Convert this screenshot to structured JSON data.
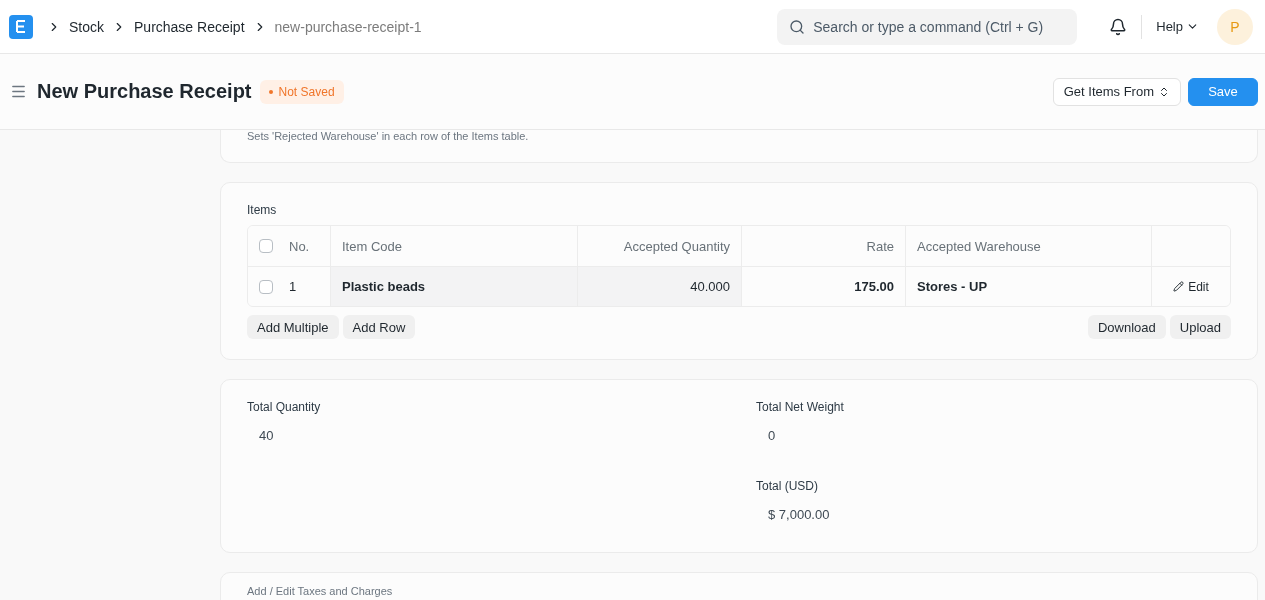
{
  "navbar": {
    "breadcrumbs": [
      {
        "label": "Stock",
        "current": false
      },
      {
        "label": "Purchase Receipt",
        "current": false
      },
      {
        "label": "new-purchase-receipt-1",
        "current": true
      }
    ],
    "search": {
      "placeholder": "Search or type a command (Ctrl + G)"
    },
    "help": "Help",
    "avatar": "P"
  },
  "page_head": {
    "title": "New Purchase Receipt",
    "status": "Not Saved",
    "buttons": [
      {
        "label": "Get Items From",
        "kind": "dropdown"
      },
      {
        "label": "Save",
        "kind": "primary"
      }
    ]
  },
  "rejected_hint": "Sets 'Rejected Warehouse' in each row of the Items table.",
  "items": {
    "label": "Items",
    "columns": [
      "No.",
      "Item Code",
      "Accepted Quantity",
      "Rate",
      "Accepted Warehouse"
    ],
    "rows": [
      {
        "checked": false,
        "no": "1",
        "item_code": "Plastic beads",
        "accepted_quantity": "40.000",
        "rate": "175.00",
        "accepted_warehouse": "Stores - UP",
        "edit": "Edit"
      }
    ],
    "left_buttons": [
      "Add Multiple",
      "Add Row"
    ],
    "right_buttons": [
      "Download",
      "Upload"
    ],
    "all_checked": false
  },
  "totals": [
    {
      "label": "Total Quantity",
      "value": "40"
    },
    {
      "label": "Total Net Weight",
      "value": "0"
    },
    {
      "label": "Total (USD)",
      "value": "$ 7,000.00"
    }
  ],
  "taxes_section": "Add / Edit Taxes and Charges"
}
